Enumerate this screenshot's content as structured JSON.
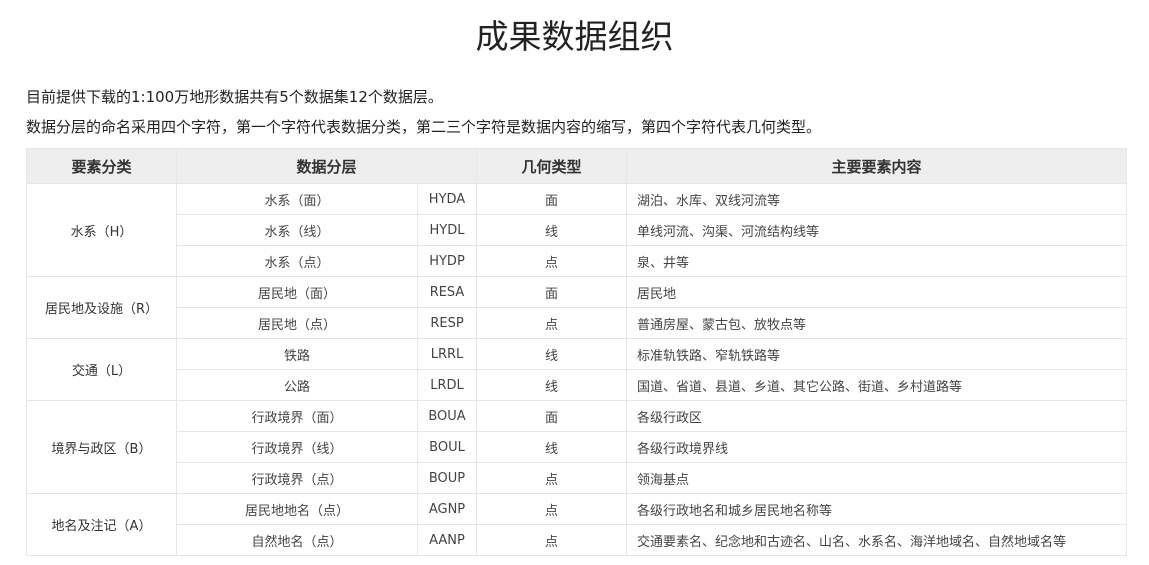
{
  "page": {
    "title": "成果数据组织",
    "intro_lines": [
      "目前提供下载的1:100万地形数据共有5个数据集12个数据层。",
      "数据分层的命名采用四个字符，第一个字符代表数据分类，第二三个字符是数据内容的缩写，第四个字符代表几何类型。"
    ]
  },
  "table": {
    "headers": [
      "要素分类",
      "数据分层",
      "几何类型",
      "主要要素内容"
    ],
    "groups": [
      {
        "category": "水系（H）",
        "rows": [
          {
            "layer": "水系（面）",
            "code": "HYDA",
            "geometry": "面",
            "content": "湖泊、水库、双线河流等"
          },
          {
            "layer": "水系（线）",
            "code": "HYDL",
            "geometry": "线",
            "content": "单线河流、沟渠、河流结构线等"
          },
          {
            "layer": "水系（点）",
            "code": "HYDP",
            "geometry": "点",
            "content": "泉、井等"
          }
        ]
      },
      {
        "category": "居民地及设施（R）",
        "rows": [
          {
            "layer": "居民地（面）",
            "code": "RESA",
            "geometry": "面",
            "content": "居民地"
          },
          {
            "layer": "居民地（点）",
            "code": "RESP",
            "geometry": "点",
            "content": "普通房屋、蒙古包、放牧点等"
          }
        ]
      },
      {
        "category": "交通（L）",
        "rows": [
          {
            "layer": "铁路",
            "code": "LRRL",
            "geometry": "线",
            "content": "标准轨铁路、窄轨铁路等"
          },
          {
            "layer": "公路",
            "code": "LRDL",
            "geometry": "线",
            "content": "国道、省道、县道、乡道、其它公路、街道、乡村道路等"
          }
        ]
      },
      {
        "category": "境界与政区（B）",
        "rows": [
          {
            "layer": "行政境界（面）",
            "code": "BOUA",
            "geometry": "面",
            "content": "各级行政区"
          },
          {
            "layer": "行政境界（线）",
            "code": "BOUL",
            "geometry": "线",
            "content": "各级行政境界线"
          },
          {
            "layer": "行政境界（点）",
            "code": "BOUP",
            "geometry": "点",
            "content": "领海基点"
          }
        ]
      },
      {
        "category": "地名及注记（A）",
        "rows": [
          {
            "layer": "居民地地名（点）",
            "code": "AGNP",
            "geometry": "点",
            "content": "各级行政地名和城乡居民地名称等"
          },
          {
            "layer": "自然地名（点）",
            "code": "AANP",
            "geometry": "点",
            "content": "交通要素名、纪念地和古迹名、山名、水系名、海洋地域名、自然地域名等"
          }
        ]
      }
    ]
  }
}
